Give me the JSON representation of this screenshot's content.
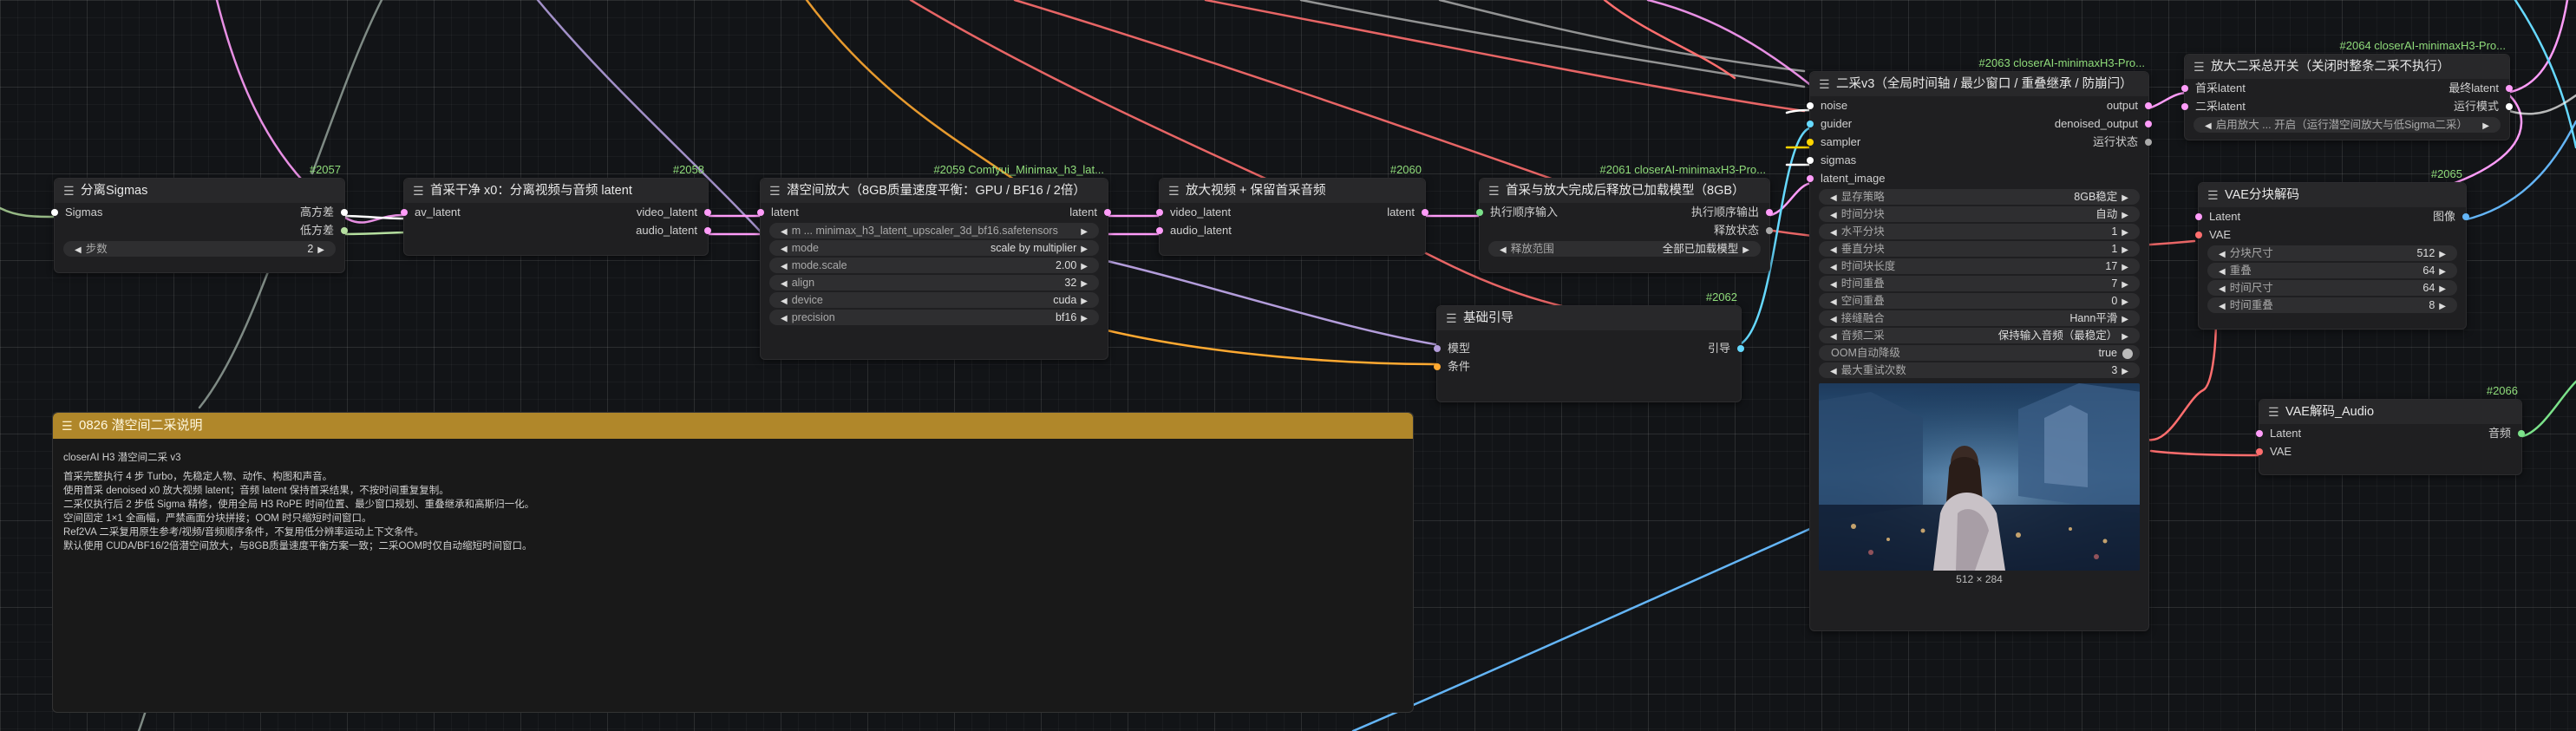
{
  "colors": {
    "latent": "#ff9cf9",
    "sigmas": "#ffffff",
    "model": "#b39ddb",
    "conditioning": "#ffa931",
    "noise": "#ffffff",
    "guider": "#66d9ff",
    "sampler": "#ffd500",
    "image": "#64b5f6",
    "vae": "#ff6e6e",
    "audio": "#7be28a",
    "node_id": "#8fdc7a",
    "note_header": "#b0872a"
  },
  "nodes": {
    "sigmas_split": {
      "id": "#2057",
      "title": "分离Sigmas",
      "input": "Sigmas",
      "out_high": "高方差",
      "out_low": "低方差",
      "steps_label": "步数",
      "steps_value": "2"
    },
    "latent_clean": {
      "id": "#2058",
      "title": "首采干净 x0：分离视频与音频 latent",
      "input": "av_latent",
      "out_video": "video_latent",
      "out_audio": "audio_latent"
    },
    "latent_upscale": {
      "id": "#2059 Comfyui_Minimax_h3_lat...",
      "title": "潜空间放大（8GB质量速度平衡：GPU / BF16 / 2倍）",
      "input": "latent",
      "output": "latent",
      "model_value": "m ... minimax_h3_latent_upscaler_3d_bf16.safetensors",
      "mode_label": "mode",
      "mode_value": "scale by multiplier",
      "scale_label": "mode.scale",
      "scale_value": "2.00",
      "align_label": "align",
      "align_value": "32",
      "device_label": "device",
      "device_value": "cuda",
      "precision_label": "precision",
      "precision_value": "bf16"
    },
    "upscale_video": {
      "id": "#2060",
      "title": "放大视频 + 保留首采音频",
      "in_video": "video_latent",
      "in_audio": "audio_latent",
      "output": "latent"
    },
    "release_model": {
      "id": "#2061 closerAI-minimaxH3-Pro...",
      "title": "首采与放大完成后释放已加载模型（8GB）",
      "input": "执行顺序输入",
      "out_order": "执行顺序输出",
      "out_status": "释放状态",
      "scope_label": "释放范围",
      "scope_value": "全部已加载模型"
    },
    "basic_guider": {
      "id": "#2062",
      "title": "基础引导",
      "in_model": "模型",
      "in_cond": "条件",
      "output": "引导"
    },
    "second_sampler": {
      "id": "#2063 closerAI-minimaxH3-Pro...",
      "title": "二采v3（全局时间轴 / 最少窗口 / 重叠继承 / 防崩闩）",
      "in_noise": "noise",
      "in_guider": "guider",
      "in_sampler": "sampler",
      "in_sigmas": "sigmas",
      "in_latent": "latent_image",
      "out_output": "output",
      "out_denoised": "denoised_output",
      "out_status": "运行状态",
      "widgets": [
        {
          "label": "显存策略",
          "value": "8GB稳定"
        },
        {
          "label": "时间分块",
          "value": "自动"
        },
        {
          "label": "水平分块",
          "value": "1"
        },
        {
          "label": "垂直分块",
          "value": "1"
        },
        {
          "label": "时间块长度",
          "value": "17"
        },
        {
          "label": "时间重叠",
          "value": "7"
        },
        {
          "label": "空间重叠",
          "value": "0"
        },
        {
          "label": "接缝融合",
          "value": "Hann平滑"
        },
        {
          "label": "音频二采",
          "value": "保持输入音频（最稳定）"
        }
      ],
      "oom_label": "OOM自动降级",
      "oom_value": "true",
      "retry_label": "最大重试次数",
      "retry_value": "3",
      "preview_caption": "512 × 284"
    },
    "second_switch": {
      "id": "#2064 closerAI-minimaxH3-Pro...",
      "title": "放大二采总开关（关闭时整条二采不执行）",
      "in_first": "首采latent",
      "in_second": "二采latent",
      "out_final": "最终latent",
      "out_mode": "运行模式",
      "toggle_value": "启用放大 ... 开启（运行潜空间放大与低Sigma二采）"
    },
    "vae_decode": {
      "id": "#2065",
      "title": "VAE分块解码",
      "in_latent": "Latent",
      "in_vae": "VAE",
      "output": "图像",
      "widgets": [
        {
          "label": "分块尺寸",
          "value": "512"
        },
        {
          "label": "重叠",
          "value": "64"
        },
        {
          "label": "时间尺寸",
          "value": "64"
        },
        {
          "label": "时间重叠",
          "value": "8"
        }
      ]
    },
    "vae_audio": {
      "id": "#2066",
      "title": "VAE解码_Audio",
      "in_latent": "Latent",
      "in_vae": "VAE",
      "output": "音频"
    }
  },
  "note": {
    "title": "0826 潜空间二采说明",
    "heading": "closerAI H3 潜空间二采 v3",
    "lines": [
      "首采完整执行 4 步 Turbo，先稳定人物、动作、构图和声音。",
      "使用首采 denoised x0 放大视频 latent；音频 latent 保持首采结果，不按时间重复复制。",
      "二采仅执行后 2 步低 Sigma 精修，使用全局 H3 RoPE 时间位置、最少窗口规划、重叠继承和高斯归一化。",
      "空间固定 1×1 全画幅，严禁画面分块拼接；OOM 时只缩短时间窗口。",
      "Ref2VA 二采复用原生参考/视频/音频顺序条件，不复用低分辨率运动上下文条件。",
      "默认使用 CUDA/BF16/2倍潜空间放大，与8GB质量速度平衡方案一致；二采OOM时仅自动缩短时间窗口。"
    ]
  }
}
